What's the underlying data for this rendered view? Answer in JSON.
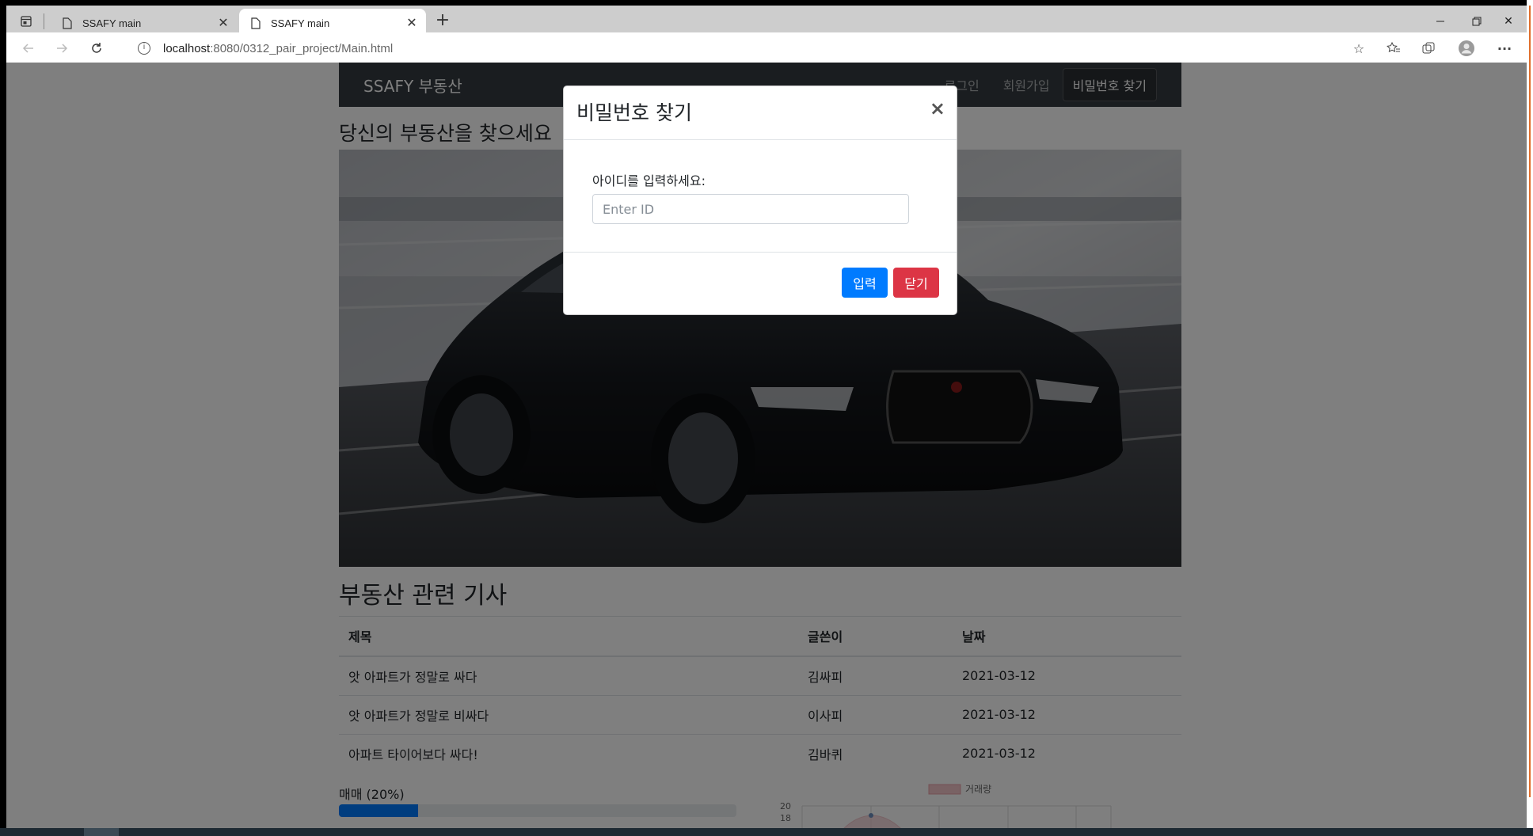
{
  "browser": {
    "tabs": [
      {
        "title": "SSAFY main",
        "active": false
      },
      {
        "title": "SSAFY main",
        "active": true
      }
    ],
    "url_host": "localhost",
    "url_path": ":8080/0312_pair_project/Main.html"
  },
  "navbar": {
    "brand": "SSAFY 부동산",
    "links": [
      "로그인",
      "회원가입"
    ],
    "active_button": "비밀번호 찾기"
  },
  "page": {
    "headline": "당신의 부동산을 찾으세요",
    "hero_image": "black-sedan-on-road",
    "articles_title": "부동산 관련 기사",
    "table": {
      "headers": [
        "제목",
        "글쓴이",
        "날짜"
      ],
      "rows": [
        [
          "앗 아파트가 정말로 싸다",
          "김싸피",
          "2021-03-12"
        ],
        [
          "앗 아파트가 정말로 비싸다",
          "이사피",
          "2021-03-12"
        ],
        [
          "아파트 타이어보다 싸다!",
          "김바퀴",
          "2021-03-12"
        ]
      ]
    },
    "progress": {
      "label": "매매 (20%)",
      "value": 20
    },
    "mini_chart": {
      "legend": "거래량",
      "yticks": [
        "20",
        "18"
      ],
      "color": "#e8a0a8"
    }
  },
  "modal": {
    "title": "비밀번호 찾기",
    "close_symbol": "×",
    "field_label": "아이디를 입력하세요:",
    "field_placeholder": "Enter ID",
    "field_value": "",
    "submit_label": "입력",
    "close_label": "닫기"
  },
  "colors": {
    "primary": "#007bff",
    "danger": "#dc3545",
    "navbar": "#343a40"
  }
}
